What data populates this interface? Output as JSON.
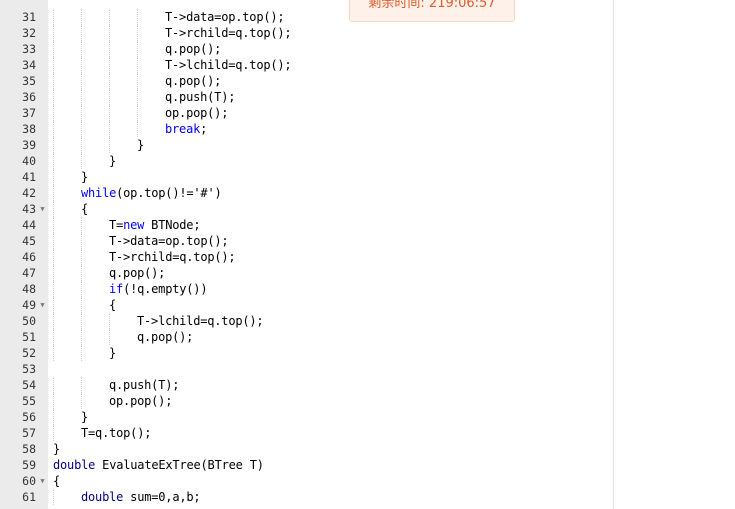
{
  "timer": {
    "text": "剩余时间: 219:06:57"
  },
  "colors": {
    "keyword": "#0000ff",
    "gutter": "#ebebeb",
    "timer_text": "#e25c2a",
    "timer_bg": "#fdf1e9"
  },
  "icons": {
    "fold": "fold-triangle-icon"
  },
  "lines": [
    {
      "num": "31",
      "fold": false,
      "indent": 4,
      "tokens": [
        {
          "t": "T->data=op.top();"
        }
      ]
    },
    {
      "num": "32",
      "fold": false,
      "indent": 4,
      "tokens": [
        {
          "t": "T->rchild=q.top();"
        }
      ]
    },
    {
      "num": "33",
      "fold": false,
      "indent": 4,
      "tokens": [
        {
          "t": "q.pop();"
        }
      ]
    },
    {
      "num": "34",
      "fold": false,
      "indent": 4,
      "tokens": [
        {
          "t": "T->lchild=q.top();"
        }
      ]
    },
    {
      "num": "35",
      "fold": false,
      "indent": 4,
      "tokens": [
        {
          "t": "q.pop();"
        }
      ]
    },
    {
      "num": "36",
      "fold": false,
      "indent": 4,
      "tokens": [
        {
          "t": "q.push(T);"
        }
      ]
    },
    {
      "num": "37",
      "fold": false,
      "indent": 4,
      "tokens": [
        {
          "t": "op.pop();"
        }
      ]
    },
    {
      "num": "38",
      "fold": false,
      "indent": 4,
      "tokens": [
        {
          "t": "break",
          "k": "kw"
        },
        {
          "t": ";"
        }
      ]
    },
    {
      "num": "39",
      "fold": false,
      "indent": 3,
      "tokens": [
        {
          "t": "}"
        }
      ]
    },
    {
      "num": "40",
      "fold": false,
      "indent": 2,
      "tokens": [
        {
          "t": "}"
        }
      ]
    },
    {
      "num": "41",
      "fold": false,
      "indent": 1,
      "tokens": [
        {
          "t": "}"
        }
      ]
    },
    {
      "num": "42",
      "fold": false,
      "indent": 1,
      "tokens": [
        {
          "t": "while",
          "k": "kw"
        },
        {
          "t": "(op.top()!='#')"
        }
      ]
    },
    {
      "num": "43",
      "fold": true,
      "indent": 1,
      "tokens": [
        {
          "t": "{"
        }
      ]
    },
    {
      "num": "44",
      "fold": false,
      "indent": 2,
      "tokens": [
        {
          "t": "T="
        },
        {
          "t": "new",
          "k": "kw"
        },
        {
          "t": " BTNode;"
        }
      ]
    },
    {
      "num": "45",
      "fold": false,
      "indent": 2,
      "tokens": [
        {
          "t": "T->data=op.top();"
        }
      ]
    },
    {
      "num": "46",
      "fold": false,
      "indent": 2,
      "tokens": [
        {
          "t": "T->rchild=q.top();"
        }
      ]
    },
    {
      "num": "47",
      "fold": false,
      "indent": 2,
      "tokens": [
        {
          "t": "q.pop();"
        }
      ]
    },
    {
      "num": "48",
      "fold": false,
      "indent": 2,
      "tokens": [
        {
          "t": "if",
          "k": "kw"
        },
        {
          "t": "(!q.empty())"
        }
      ]
    },
    {
      "num": "49",
      "fold": true,
      "indent": 2,
      "tokens": [
        {
          "t": "{"
        }
      ]
    },
    {
      "num": "50",
      "fold": false,
      "indent": 3,
      "tokens": [
        {
          "t": "T->lchild=q.top();"
        }
      ]
    },
    {
      "num": "51",
      "fold": false,
      "indent": 3,
      "tokens": [
        {
          "t": "q.pop();"
        }
      ]
    },
    {
      "num": "52",
      "fold": false,
      "indent": 2,
      "tokens": [
        {
          "t": "}"
        }
      ]
    },
    {
      "num": "53",
      "fold": false,
      "indent": 0,
      "tokens": []
    },
    {
      "num": "54",
      "fold": false,
      "indent": 2,
      "tokens": [
        {
          "t": "q.push(T);"
        }
      ]
    },
    {
      "num": "55",
      "fold": false,
      "indent": 2,
      "tokens": [
        {
          "t": "op.pop();"
        }
      ]
    },
    {
      "num": "56",
      "fold": false,
      "indent": 1,
      "tokens": [
        {
          "t": "}"
        }
      ]
    },
    {
      "num": "57",
      "fold": false,
      "indent": 1,
      "tokens": [
        {
          "t": "T=q.top();"
        }
      ]
    },
    {
      "num": "58",
      "fold": false,
      "indent": 0,
      "tokens": [
        {
          "t": "}"
        }
      ]
    },
    {
      "num": "59",
      "fold": false,
      "indent": 0,
      "tokens": [
        {
          "t": "double",
          "k": "ty"
        },
        {
          "t": " EvaluateExTree(BTree T)"
        }
      ]
    },
    {
      "num": "60",
      "fold": true,
      "indent": 0,
      "tokens": [
        {
          "t": "{"
        }
      ]
    },
    {
      "num": "61",
      "fold": false,
      "indent": 1,
      "tokens": [
        {
          "t": "double",
          "k": "ty"
        },
        {
          "t": " sum=0,a,b;"
        }
      ]
    }
  ]
}
